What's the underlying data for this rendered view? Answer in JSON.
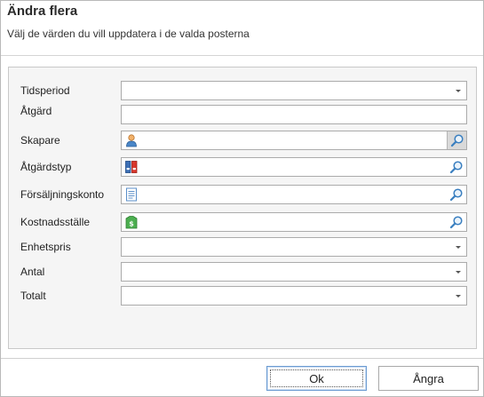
{
  "dialog": {
    "title": "Ändra flera",
    "subtitle": "Välj de värden du vill uppdatera i de valda posterna"
  },
  "form": {
    "fields": [
      {
        "label": "Tidsperiod",
        "value": "",
        "kind": "dropdown"
      },
      {
        "label": "Åtgärd",
        "value": "",
        "kind": "text"
      },
      {
        "label": "Skapare",
        "value": "",
        "kind": "lookup",
        "icon": "person-icon"
      },
      {
        "label": "Åtgärdstyp",
        "value": "",
        "kind": "lookup",
        "icon": "binders-icon"
      },
      {
        "label": "Försäljningskonto",
        "value": "",
        "kind": "lookup",
        "icon": "ledger-icon"
      },
      {
        "label": "Kostnadsställe",
        "value": "",
        "kind": "lookup",
        "icon": "money-icon"
      },
      {
        "label": "Enhetspris",
        "value": "",
        "kind": "dropdown"
      },
      {
        "label": "Antal",
        "value": "",
        "kind": "dropdown"
      },
      {
        "label": "Totalt",
        "value": "",
        "kind": "dropdown"
      }
    ]
  },
  "footer": {
    "ok_label": "Ok",
    "cancel_label": "Ångra"
  },
  "colors": {
    "accent": "#6b9bd1",
    "search_icon": "#3a7fc0"
  }
}
